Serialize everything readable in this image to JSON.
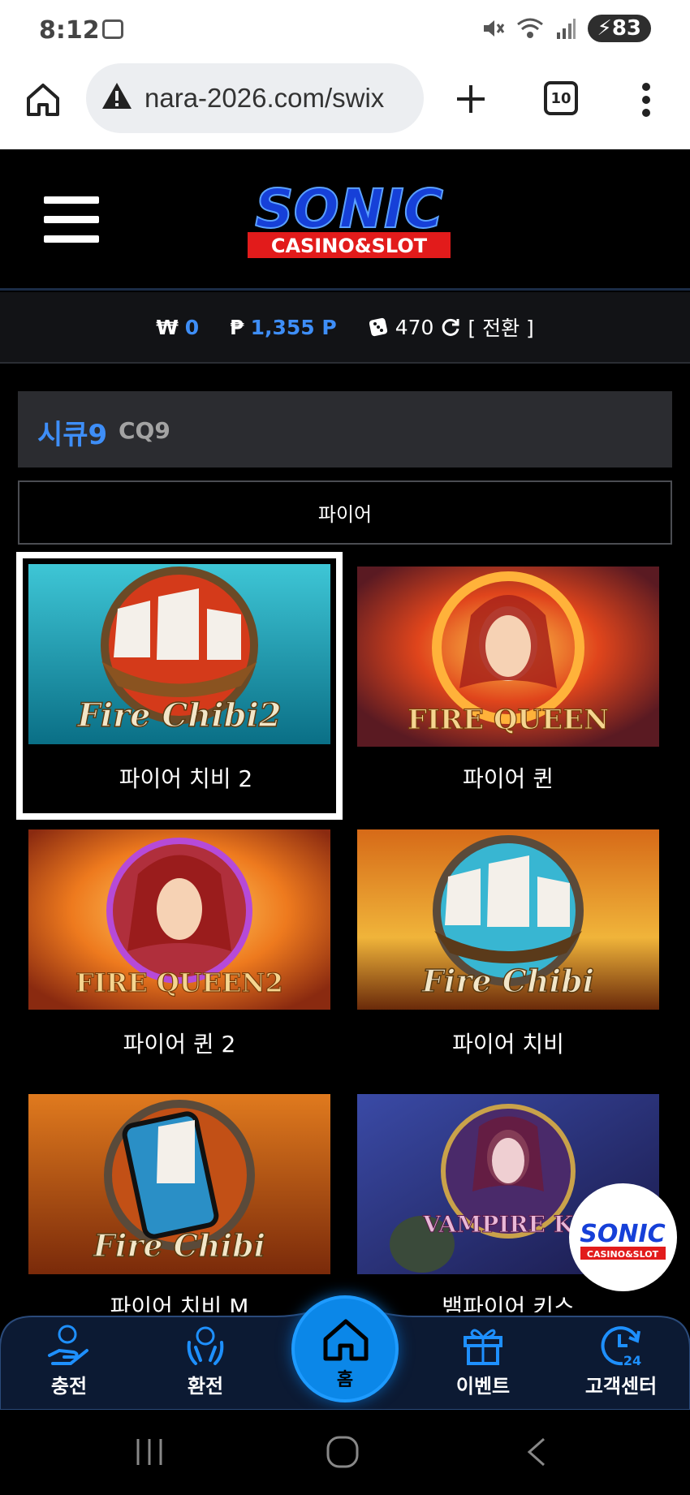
{
  "status_bar": {
    "time": "8:12",
    "battery": "83"
  },
  "browser": {
    "url": "nara-2026.com/swix",
    "tab_count": "10"
  },
  "logo": {
    "brand": "SONIC",
    "tagline": "CASINO&SLOT"
  },
  "balance": {
    "won_symbol": "₩",
    "won_value": "0",
    "point_symbol": "₱",
    "point_value": "1,355 P",
    "chip_value": "470",
    "switch_label": "[ 전환 ]"
  },
  "provider": {
    "name_ko": "시큐9",
    "name_en": "CQ9"
  },
  "search": {
    "value": "파이어"
  },
  "games": [
    {
      "title": "파이어 치비 2",
      "art": "Fire Chibi2"
    },
    {
      "title": "파이어 퀸",
      "art": "FIRE QUEEN"
    },
    {
      "title": "파이어 퀸 2",
      "art": "FIRE QUEEN2"
    },
    {
      "title": "파이어 치비",
      "art": "Fire Chibi"
    },
    {
      "title": "파이어 치비 M",
      "art": "Fire Chibi"
    },
    {
      "title": "뱀파이어 키스",
      "art": "VAMPIRE KISS"
    }
  ],
  "bottom_nav": {
    "deposit": "충전",
    "withdraw": "환전",
    "home": "홈",
    "event": "이벤트",
    "support": "고객센터"
  },
  "colors": {
    "accent": "#3e8ef7",
    "home_button": "#0b87e8"
  }
}
